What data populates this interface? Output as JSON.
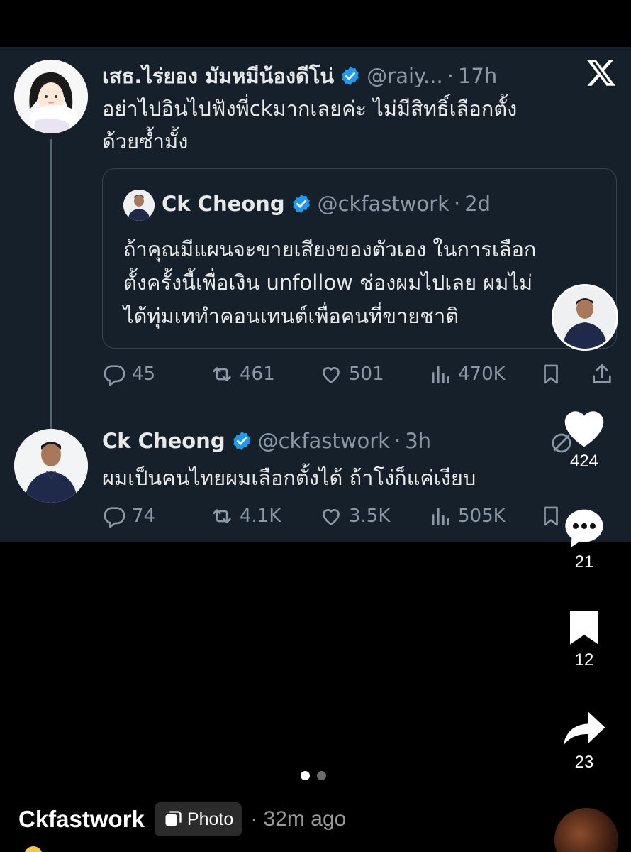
{
  "tweet_main": {
    "name": "เสธ.ไร่ยอง มัมหมีน้องดีโน่",
    "handle": "@raiy...",
    "separator": "·",
    "time": "17h",
    "text_line1": "อย่าไปอินไปฟังพี่ckมากเลยค่ะ ไม่มีสิทธิ์เลือกตั้ง",
    "text_line2": "ด้วยซ้ำมั้ง",
    "replies": "45",
    "reposts": "461",
    "likes": "501",
    "views": "470K"
  },
  "quoted_tweet": {
    "name": "Ck Cheong",
    "handle": "@ckfastwork",
    "separator": "·",
    "time": "2d",
    "text_line1": "ถ้าคุณมีแผนจะขายเสียงของตัวเอง ในการเลือก",
    "text_line2": "ตั้งครั้งนี้เพื่อเงิน unfollow ช่องผมไปเลย ผมไม่",
    "text_line3": "ได้ทุ่มเททำคอนเทนต์เพื่อคนที่ขายชาติ"
  },
  "tweet_reply": {
    "name": "Ck Cheong",
    "handle": "@ckfastwork",
    "separator": "·",
    "time": "3h",
    "text": "ผมเป็นคนไทยผมเลือกตั้งได้ ถ้าโง่ก็แค่เงียบ",
    "replies": "74",
    "reposts": "4.1K",
    "likes": "3.5K",
    "views": "505K"
  },
  "overlay": {
    "likes": "424",
    "comments": "21",
    "saves": "12",
    "shares": "23",
    "page_dots": 2,
    "active_dot": 0
  },
  "footer": {
    "author": "Ckfastwork",
    "badge": "Photo",
    "time_ago": "· 32m ago"
  },
  "colors": {
    "tweet_bg": "#15202b",
    "verified": "#1d9bf0",
    "muted": "#8b98a5",
    "page_bg": "#000000"
  }
}
